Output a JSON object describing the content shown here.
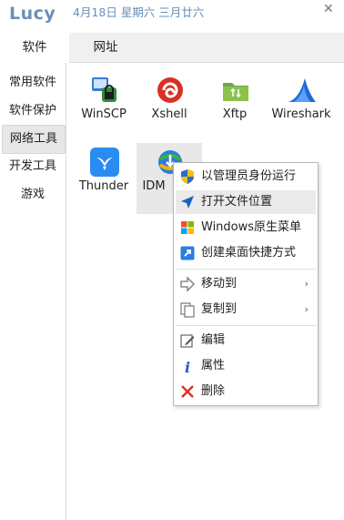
{
  "app": {
    "name": "Lucy",
    "date": "4月18日 星期六 三月廿六",
    "close": "✕"
  },
  "tabs": [
    {
      "label": "软件",
      "active": true
    },
    {
      "label": "网址",
      "active": false
    }
  ],
  "sidebar": [
    {
      "label": "常用软件"
    },
    {
      "label": "软件保护"
    },
    {
      "label": "网络工具",
      "active": true
    },
    {
      "label": "开发工具"
    },
    {
      "label": "游戏"
    }
  ],
  "apps": [
    {
      "label": "WinSCP",
      "icon": "winscp-icon"
    },
    {
      "label": "Xshell",
      "icon": "xshell-icon"
    },
    {
      "label": "Xftp",
      "icon": "xftp-icon"
    },
    {
      "label": "Wireshark",
      "icon": "wireshark-icon"
    },
    {
      "label": "Thunder",
      "icon": "thunder-icon"
    },
    {
      "label": "IDM",
      "icon": "idm-icon",
      "selected": true
    }
  ],
  "context_menu": {
    "items": [
      {
        "label": "以管理员身份运行",
        "icon": "shield-icon"
      },
      {
        "label": "打开文件位置",
        "icon": "navigate-arrow-icon",
        "hover": true
      },
      {
        "label": "Windows原生菜单",
        "icon": "windows-logo-icon"
      },
      {
        "label": "创建桌面快捷方式",
        "icon": "shortcut-icon"
      },
      {
        "label": "移动到",
        "icon": "move-arrow-icon",
        "submenu": true
      },
      {
        "label": "复制到",
        "icon": "copy-icon",
        "submenu": true
      },
      {
        "label": "编辑",
        "icon": "edit-icon"
      },
      {
        "label": "属性",
        "icon": "info-icon"
      },
      {
        "label": "删除",
        "icon": "delete-x-icon"
      }
    ],
    "submenu_arrow": "›"
  }
}
